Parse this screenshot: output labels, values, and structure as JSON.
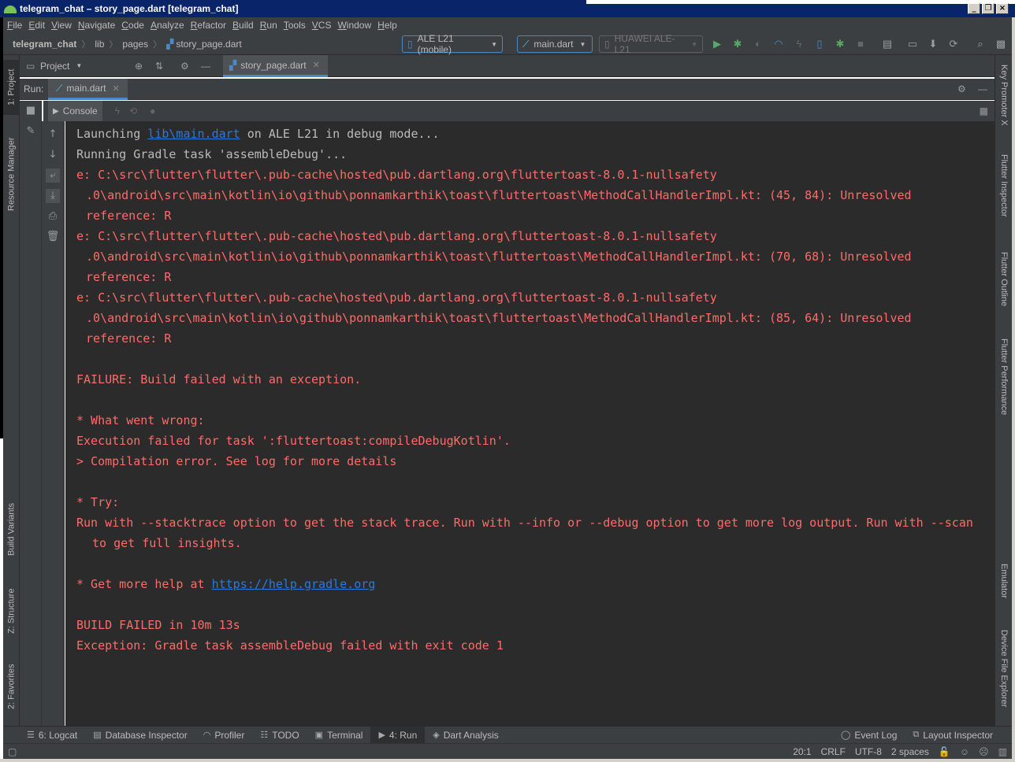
{
  "window": {
    "title": "telegram_chat – story_page.dart [telegram_chat]"
  },
  "menu": [
    "File",
    "Edit",
    "View",
    "Navigate",
    "Code",
    "Analyze",
    "Refactor",
    "Build",
    "Run",
    "Tools",
    "VCS",
    "Window",
    "Help"
  ],
  "breadcrumb": {
    "project": "telegram_chat",
    "dir1": "lib",
    "dir2": "pages",
    "file": "story_page.dart"
  },
  "toolbar": {
    "device": "ALE L21 (mobile)",
    "config": "main.dart",
    "target": "HUAWEI ALE-L21"
  },
  "left_tabs": {
    "project": "1: Project",
    "resource_manager": "Resource Manager",
    "build_variants": "Build Variants",
    "structure": "Z: Structure",
    "favorites": "2: Favorites"
  },
  "right_tabs": {
    "key_promoter": "Key Promoter X",
    "flutter_inspector": "Flutter Inspector",
    "flutter_outline": "Flutter Outline",
    "flutter_performance": "Flutter Performance",
    "emulator": "Emulator",
    "device_file_explorer": "Device File Explorer"
  },
  "project_panel": {
    "label": "Project"
  },
  "editor_tab": {
    "label": "story_page.dart"
  },
  "run_panel": {
    "label": "Run:",
    "tab": "main.dart",
    "console_tab": "Console"
  },
  "console": {
    "l1_pre": "Launching ",
    "l1_link": "lib\\main.dart",
    "l1_post": " on ALE L21 in debug mode...",
    "l2": "Running Gradle task 'assembleDebug'...",
    "e1a": "e: C:\\src\\flutter\\flutter\\.pub-cache\\hosted\\pub.dartlang.org\\fluttertoast-8.0.1-nullsafety",
    "e1b": ".0\\android\\src\\main\\kotlin\\io\\github\\ponnamkarthik\\toast\\fluttertoast\\MethodCallHandlerImpl.kt: (45, 84): Unresolved",
    "e1c": "reference: R",
    "e2a": "e: C:\\src\\flutter\\flutter\\.pub-cache\\hosted\\pub.dartlang.org\\fluttertoast-8.0.1-nullsafety",
    "e2b": ".0\\android\\src\\main\\kotlin\\io\\github\\ponnamkarthik\\toast\\fluttertoast\\MethodCallHandlerImpl.kt: (70, 68): Unresolved",
    "e2c": "reference: R",
    "e3a": "e: C:\\src\\flutter\\flutter\\.pub-cache\\hosted\\pub.dartlang.org\\fluttertoast-8.0.1-nullsafety",
    "e3b": ".0\\android\\src\\main\\kotlin\\io\\github\\ponnamkarthik\\toast\\fluttertoast\\MethodCallHandlerImpl.kt: (85, 64): Unresolved",
    "e3c": "reference: R",
    "failure": "FAILURE: Build failed with an exception.",
    "wrong_hdr": "* What went wrong:",
    "wrong1": "Execution failed for task ':fluttertoast:compileDebugKotlin'.",
    "wrong2": "> Compilation error. See log for more details",
    "try_hdr": "* Try:",
    "try1": "Run with --stacktrace option to get the stack trace. Run with --info or --debug option to get more log output. Run with --scan",
    "try2": "to get full insights.",
    "help_pre": "* Get more help at ",
    "help_link": "https://help.gradle.org",
    "build_failed": "BUILD FAILED in 10m 13s",
    "exception": "Exception: Gradle task assembleDebug failed with exit code 1"
  },
  "bottom_tabs": {
    "logcat": "6: Logcat",
    "db_inspector": "Database Inspector",
    "profiler": "Profiler",
    "todo": "TODO",
    "terminal": "Terminal",
    "run": "4: Run",
    "dart_analysis": "Dart Analysis",
    "event_log": "Event Log",
    "layout_inspector": "Layout Inspector"
  },
  "status": {
    "position": "20:1",
    "line_sep": "CRLF",
    "encoding": "UTF-8",
    "indent": "2 spaces"
  },
  "colors": {
    "error": "#ff6b68",
    "link": "#287bde",
    "accent": "#4a88c7",
    "bg": "#2b2b2b"
  }
}
